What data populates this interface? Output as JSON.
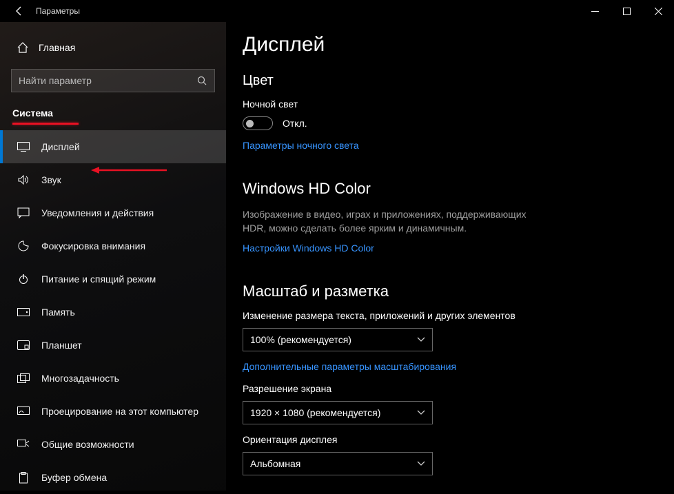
{
  "window": {
    "title": "Параметры"
  },
  "sidebar": {
    "home": "Главная",
    "search_placeholder": "Найти параметр",
    "category": "Система",
    "items": [
      {
        "icon": "display-icon",
        "label": "Дисплей",
        "selected": true
      },
      {
        "icon": "sound-icon",
        "label": "Звук"
      },
      {
        "icon": "notifications-icon",
        "label": "Уведомления и действия"
      },
      {
        "icon": "focus-icon",
        "label": "Фокусировка внимания"
      },
      {
        "icon": "power-icon",
        "label": "Питание и спящий режим"
      },
      {
        "icon": "storage-icon",
        "label": "Память"
      },
      {
        "icon": "tablet-icon",
        "label": "Планшет"
      },
      {
        "icon": "multitask-icon",
        "label": "Многозадачность"
      },
      {
        "icon": "projecting-icon",
        "label": "Проецирование на этот компьютер"
      },
      {
        "icon": "shared-icon",
        "label": "Общие возможности"
      },
      {
        "icon": "clipboard-icon",
        "label": "Буфер обмена"
      }
    ]
  },
  "page": {
    "title": "Дисплей",
    "color_section": "Цвет",
    "night_light_label": "Ночной свет",
    "night_light_state": "Откл.",
    "night_light_link": "Параметры ночного света",
    "hd_section": "Windows HD Color",
    "hd_desc": "Изображение в видео, играх и приложениях, поддерживающих HDR, можно сделать более ярким и динамичным.",
    "hd_link": "Настройки Windows HD Color",
    "scale_section": "Масштаб и разметка",
    "scale_label": "Изменение размера текста, приложений и других элементов",
    "scale_value": "100% (рекомендуется)",
    "scale_link": "Дополнительные параметры масштабирования",
    "resolution_label": "Разрешение экрана",
    "resolution_value": "1920 × 1080 (рекомендуется)",
    "orientation_label": "Ориентация дисплея",
    "orientation_value": "Альбомная"
  }
}
